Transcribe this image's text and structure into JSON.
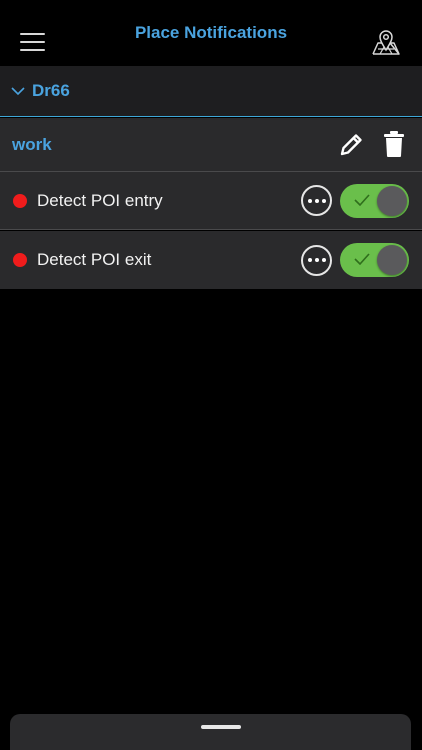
{
  "header": {
    "title": "Place Notifications",
    "menu_icon": "hamburger-menu-icon",
    "map_icon": "map-pin-icon"
  },
  "group": {
    "label": "Dr66",
    "expanded": true,
    "chevron_icon": "chevron-down-icon"
  },
  "place": {
    "name": "work",
    "edit_icon": "pencil-icon",
    "delete_icon": "trash-icon"
  },
  "notifications": [
    {
      "label": "Detect POI entry",
      "enabled": true,
      "status_color": "#f01c1c",
      "more_icon": "ellipsis-icon"
    },
    {
      "label": "Detect POI exit",
      "enabled": true,
      "status_color": "#f01c1c",
      "more_icon": "ellipsis-icon"
    }
  ],
  "colors": {
    "accent": "#4aa3df",
    "toggle_on": "#6abf4b",
    "background": "#000000",
    "row": "#2a2a2c"
  }
}
